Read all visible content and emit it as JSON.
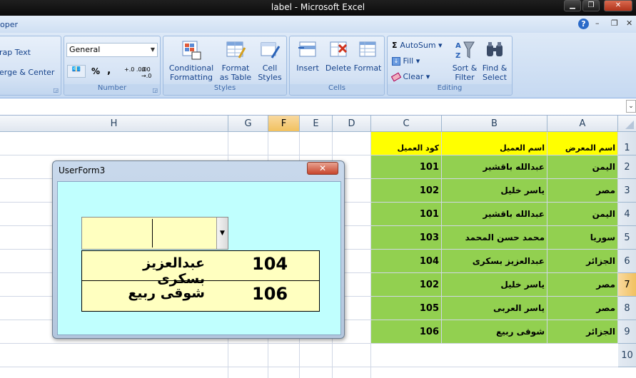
{
  "window": {
    "title": "label - Microsoft Excel",
    "minimize": "▁",
    "restore": "❐",
    "close": "✕"
  },
  "tabbar": {
    "left_text": "oper",
    "help": "?",
    "mini_min": "–",
    "mini_restore": "❐",
    "mini_close": "✕"
  },
  "ribbon": {
    "alignment": {
      "wrap_text": "rap Text",
      "merge_center": "erge & Center"
    },
    "number": {
      "label": "Number",
      "format_value": "General",
      "percent": "%",
      "comma": ",",
      "inc_dec": "+.0 .00",
      "dec_dec": ".00 →.0"
    },
    "styles": {
      "label": "Styles",
      "cond_fmt_line1": "Conditional",
      "cond_fmt_line2": "Formatting",
      "fmt_table_line1": "Format",
      "fmt_table_line2": "as Table",
      "cell_styles_line1": "Cell",
      "cell_styles_line2": "Styles"
    },
    "cells": {
      "label": "Cells",
      "insert": "Insert",
      "delete": "Delete",
      "format": "Format"
    },
    "editing": {
      "label": "Editing",
      "autosum": "AutoSum",
      "fill": "Fill",
      "clear": "Clear",
      "sort_line1": "Sort &",
      "sort_line2": "Filter",
      "find_line1": "Find &",
      "find_line2": "Select"
    }
  },
  "sheet": {
    "columns": [
      "H",
      "G",
      "F",
      "E",
      "D",
      "C",
      "B",
      "A"
    ],
    "selected_column": "F",
    "selected_row": "7",
    "rows": [
      "1",
      "2",
      "3",
      "4",
      "5",
      "6",
      "7",
      "8",
      "9",
      "10"
    ],
    "headers": {
      "c": "كود العميل",
      "b": "اسم العميل",
      "a": "اسم المعرض"
    },
    "data": [
      {
        "c": "101",
        "b": "عبدالله باقشير",
        "a": "اليمن"
      },
      {
        "c": "102",
        "b": "ياسر خليل",
        "a": "مصر"
      },
      {
        "c": "101",
        "b": "عبدالله باقشير",
        "a": "اليمن"
      },
      {
        "c": "103",
        "b": "محمد حسن المحمد",
        "a": "سوريا"
      },
      {
        "c": "104",
        "b": "عبدالعزيز بسكرى",
        "a": "الجزائر"
      },
      {
        "c": "102",
        "b": "ياسر خليل",
        "a": "مصر"
      },
      {
        "c": "105",
        "b": "ياسر العربى",
        "a": "مصر"
      },
      {
        "c": "106",
        "b": "شوقى ربيع",
        "a": "الجزائر"
      }
    ]
  },
  "userform": {
    "title": "UserForm3",
    "close": "✕",
    "combo_arrow": "▼",
    "list": [
      {
        "code": "104",
        "name": "عبدالعزيز بسكرى"
      },
      {
        "code": "106",
        "name": "شوقى ربيع"
      }
    ]
  },
  "colors": {
    "header_yellow": "#ffff00",
    "data_green": "#92d050",
    "form_bg": "#c0fffe",
    "list_bg": "#ffffc0"
  }
}
